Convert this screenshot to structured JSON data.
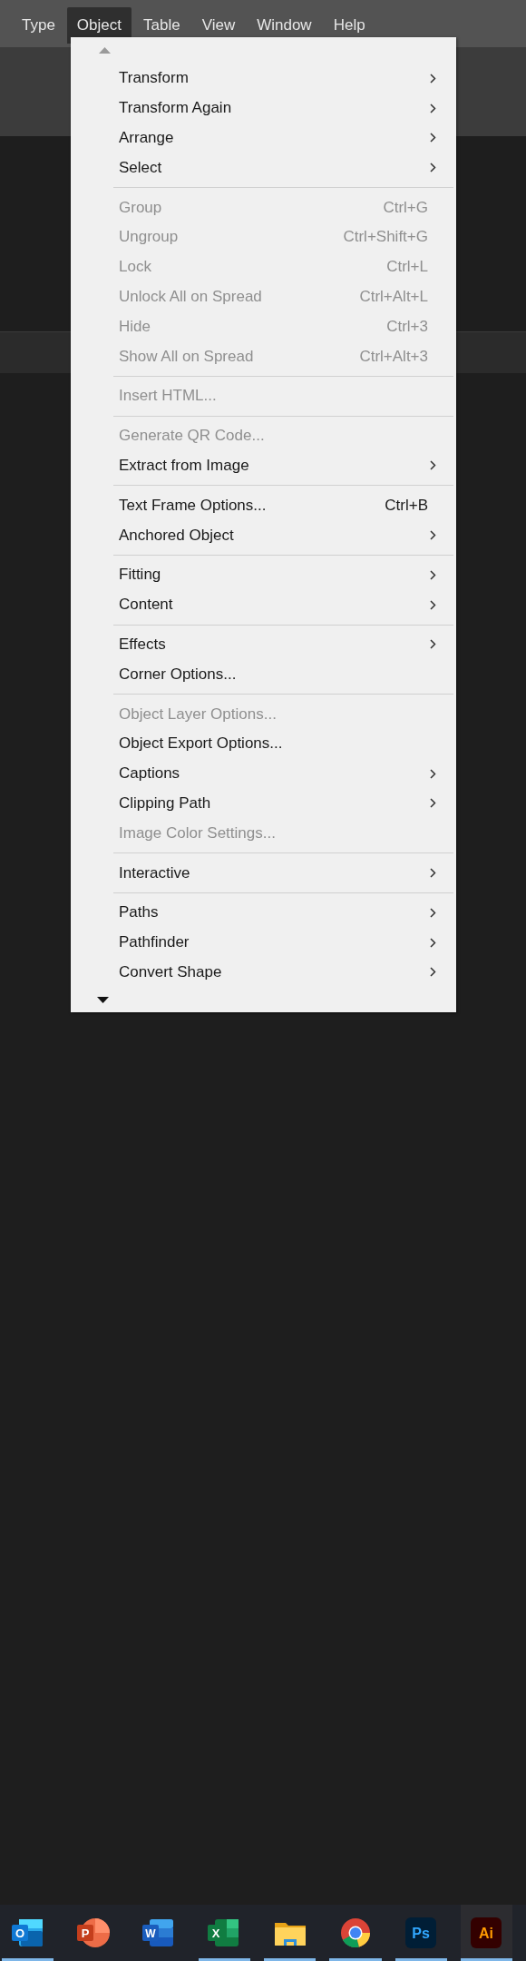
{
  "menu_bar": {
    "items": [
      {
        "label": "Type",
        "selected": false
      },
      {
        "label": "Object",
        "selected": true
      },
      {
        "label": "Table",
        "selected": false
      },
      {
        "label": "View",
        "selected": false
      },
      {
        "label": "Window",
        "selected": false
      },
      {
        "label": "Help",
        "selected": false
      }
    ]
  },
  "menu": {
    "groups": [
      {
        "items": [
          {
            "label": "Transform",
            "submenu": true,
            "disabled": false
          },
          {
            "label": "Transform Again",
            "submenu": true,
            "disabled": false
          },
          {
            "label": "Arrange",
            "submenu": true,
            "disabled": false
          },
          {
            "label": "Select",
            "submenu": true,
            "disabled": false
          }
        ]
      },
      {
        "items": [
          {
            "label": "Group",
            "shortcut": "Ctrl+G",
            "submenu": false,
            "disabled": true
          },
          {
            "label": "Ungroup",
            "shortcut": "Ctrl+Shift+G",
            "submenu": false,
            "disabled": true
          },
          {
            "label": "Lock",
            "shortcut": "Ctrl+L",
            "submenu": false,
            "disabled": true
          },
          {
            "label": "Unlock All on Spread",
            "shortcut": "Ctrl+Alt+L",
            "submenu": false,
            "disabled": true
          },
          {
            "label": "Hide",
            "shortcut": "Ctrl+3",
            "submenu": false,
            "disabled": true
          },
          {
            "label": "Show All on Spread",
            "shortcut": "Ctrl+Alt+3",
            "submenu": false,
            "disabled": true
          }
        ]
      },
      {
        "items": [
          {
            "label": "Insert HTML...",
            "submenu": false,
            "disabled": true
          }
        ]
      },
      {
        "items": [
          {
            "label": "Generate QR Code...",
            "submenu": false,
            "disabled": true
          },
          {
            "label": "Extract from Image",
            "submenu": true,
            "disabled": false
          }
        ]
      },
      {
        "items": [
          {
            "label": "Text Frame Options...",
            "shortcut": "Ctrl+B",
            "submenu": false,
            "disabled": false
          },
          {
            "label": "Anchored Object",
            "submenu": true,
            "disabled": false
          }
        ]
      },
      {
        "items": [
          {
            "label": "Fitting",
            "submenu": true,
            "disabled": false
          },
          {
            "label": "Content",
            "submenu": true,
            "disabled": false
          }
        ]
      },
      {
        "items": [
          {
            "label": "Effects",
            "submenu": true,
            "disabled": false
          },
          {
            "label": "Corner Options...",
            "submenu": false,
            "disabled": false
          }
        ]
      },
      {
        "items": [
          {
            "label": "Object Layer Options...",
            "submenu": false,
            "disabled": true
          },
          {
            "label": "Object Export Options...",
            "submenu": false,
            "disabled": false
          },
          {
            "label": "Captions",
            "submenu": true,
            "disabled": false
          },
          {
            "label": "Clipping Path",
            "submenu": true,
            "disabled": false
          },
          {
            "label": "Image Color Settings...",
            "submenu": false,
            "disabled": true
          }
        ]
      },
      {
        "items": [
          {
            "label": "Interactive",
            "submenu": true,
            "disabled": false
          }
        ]
      },
      {
        "items": [
          {
            "label": "Paths",
            "submenu": true,
            "disabled": false
          },
          {
            "label": "Pathfinder",
            "submenu": true,
            "disabled": false
          },
          {
            "label": "Convert Shape",
            "submenu": true,
            "disabled": false
          }
        ]
      }
    ]
  },
  "taskbar": {
    "apps": [
      {
        "kind": "mail",
        "label": "O",
        "running": true
      },
      {
        "kind": "slides",
        "label": "P",
        "running": false
      },
      {
        "kind": "doc",
        "label": "W",
        "running": false
      },
      {
        "kind": "sheet",
        "label": "X",
        "running": true
      },
      {
        "kind": "folder",
        "running": true
      },
      {
        "kind": "browser",
        "running": true
      },
      {
        "kind": "photo",
        "label": "Ps",
        "running": true
      },
      {
        "kind": "vector",
        "label": "Ai",
        "running": true
      }
    ]
  }
}
